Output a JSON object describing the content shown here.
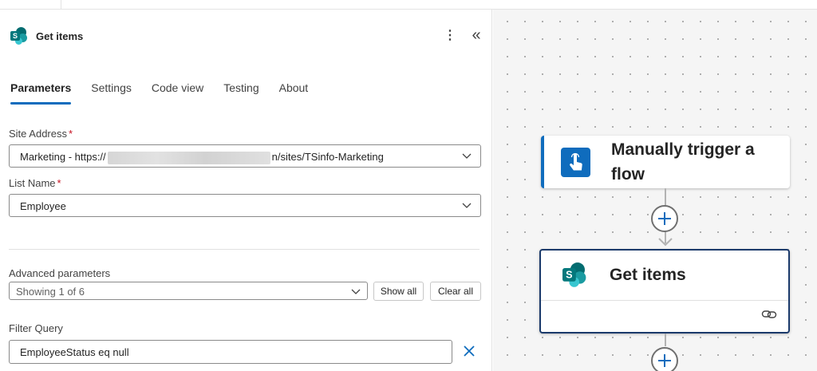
{
  "panel": {
    "title": "Get items",
    "more_icon": "⋮",
    "collapse_icon": "«",
    "tabs": [
      {
        "label": "Parameters"
      },
      {
        "label": "Settings"
      },
      {
        "label": "Code view"
      },
      {
        "label": "Testing"
      },
      {
        "label": "About"
      }
    ],
    "site_address": {
      "label": "Site Address",
      "required_mark": "*",
      "value_prefix": "Marketing - https://",
      "value_suffix": "n/sites/TSinfo-Marketing"
    },
    "list_name": {
      "label": "List Name",
      "required_mark": "*",
      "value": "Employee"
    },
    "advanced": {
      "label": "Advanced parameters",
      "selected": "Showing 1 of 6",
      "show_all": "Show all",
      "clear_all": "Clear all"
    },
    "filter_query": {
      "label": "Filter Query",
      "value": "EmployeeStatus eq null"
    }
  },
  "canvas": {
    "trigger_node": {
      "title": "Manually trigger a flow"
    },
    "action_node": {
      "title": "Get items"
    }
  },
  "colors": {
    "accent": "#0f6cbd",
    "sharepoint_dark": "#036c70",
    "sharepoint_mid": "#1a9ba1",
    "sharepoint_light": "#37c6d0",
    "selected_node_border": "#1b3a6b",
    "required": "#c50f1f"
  },
  "icons": {
    "panel_header": "sharepoint-icon",
    "trigger": "touch-hand-icon",
    "action": "sharepoint-icon",
    "connector_add": "plus-icon",
    "node_link": "link-icon",
    "dropdown": "chevron-down-icon",
    "clear": "close-icon"
  }
}
